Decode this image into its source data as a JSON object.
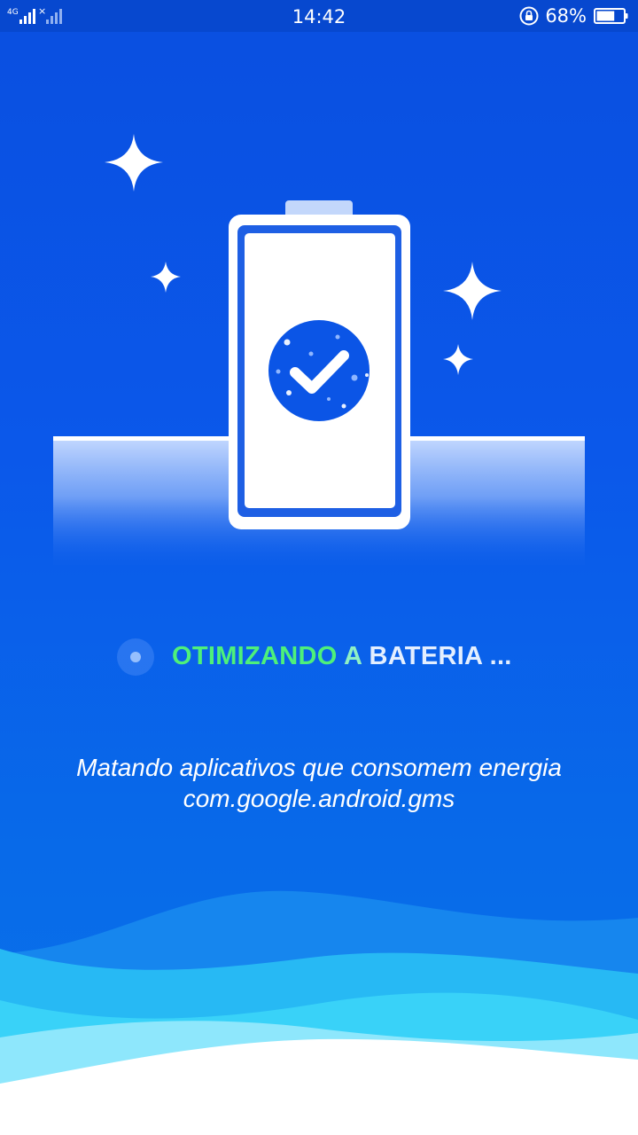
{
  "status_bar": {
    "network": "4G",
    "time": "14:42",
    "battery_percent": "68%",
    "battery_level": 0.68
  },
  "optimizing": {
    "word1": "OTIMIZANDO",
    "word2": "A",
    "word3": "BATERIA ..."
  },
  "description": {
    "line1": "Matando aplicativos que consomem energia",
    "line2": "com.google.android.gms"
  },
  "colors": {
    "background": "#0a55e6",
    "status_bar": "#0748cf",
    "highlight_green": "#4ef07a",
    "highlight_mint": "#8ff0c4",
    "check_circle": "#0b55e6"
  },
  "icons": [
    "signal-icon",
    "rotation-lock-icon",
    "battery-icon",
    "sparkle-icon",
    "battery-illustration",
    "check-circle-icon"
  ]
}
